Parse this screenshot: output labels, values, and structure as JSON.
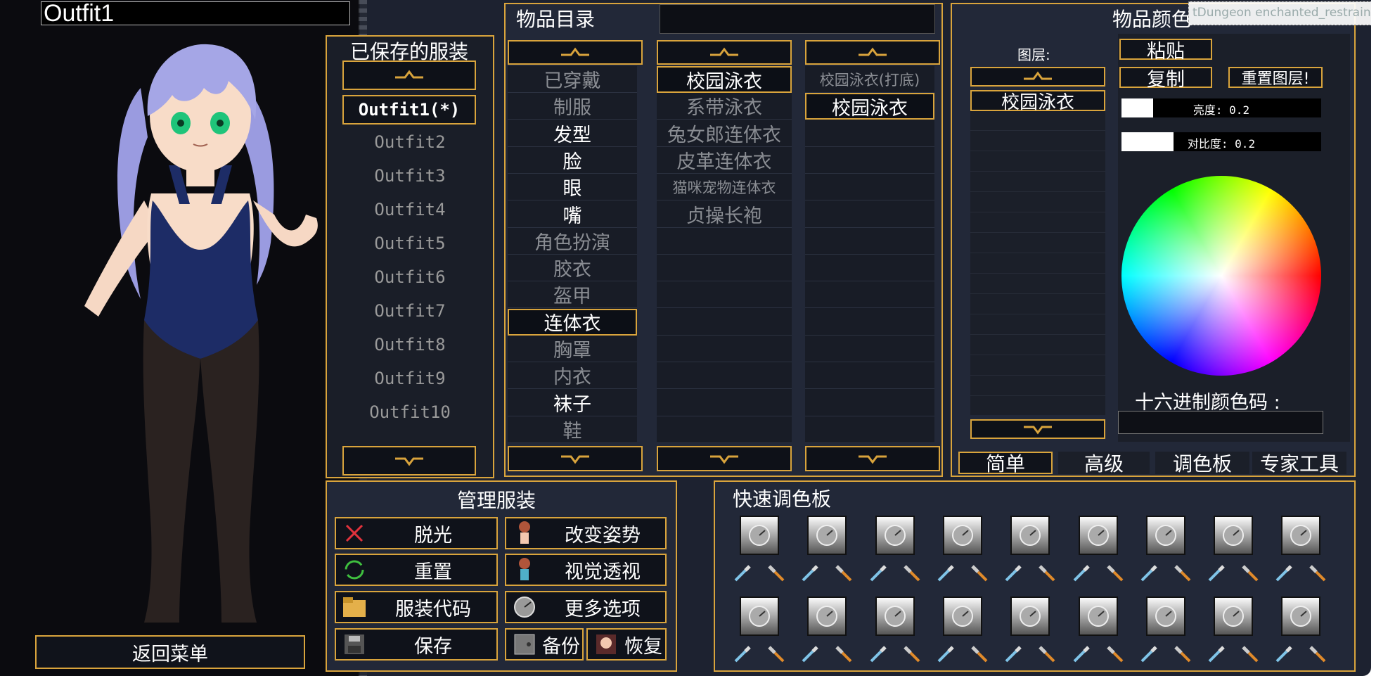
{
  "outfit_name": "Outfit1",
  "return_label": "返回菜单",
  "saved": {
    "title": "已保存的服装",
    "selected": "Outfit1(*)",
    "items": [
      "Outfit2",
      "Outfit3",
      "Outfit4",
      "Outfit5",
      "Outfit6",
      "Outfit7",
      "Outfit8",
      "Outfit9",
      "Outfit10"
    ]
  },
  "catalog": {
    "title": "物品目录",
    "search_value": "",
    "categories": [
      {
        "label": "已穿戴",
        "style": "dim"
      },
      {
        "label": "制服",
        "style": "dim"
      },
      {
        "label": "发型",
        "style": "bright"
      },
      {
        "label": "脸",
        "style": "bright"
      },
      {
        "label": "眼",
        "style": "bright"
      },
      {
        "label": "嘴",
        "style": "bright"
      },
      {
        "label": "角色扮演",
        "style": "dim"
      },
      {
        "label": "胶衣",
        "style": "dim"
      },
      {
        "label": "盔甲",
        "style": "dim"
      },
      {
        "label": "连体衣",
        "style": "selected"
      },
      {
        "label": "胸罩",
        "style": "dim"
      },
      {
        "label": "内衣",
        "style": "dim"
      },
      {
        "label": "袜子",
        "style": "bright"
      },
      {
        "label": "鞋",
        "style": "dim"
      }
    ],
    "items": [
      {
        "label": "校园泳衣",
        "style": "selected"
      },
      {
        "label": "系带泳衣",
        "style": "dim"
      },
      {
        "label": "兔女郎连体衣",
        "style": "dim"
      },
      {
        "label": "皮革连体衣",
        "style": "dim"
      },
      {
        "label": "猫咪宠物连体衣",
        "style": "dim"
      },
      {
        "label": "贞操长袍",
        "style": "dim"
      }
    ],
    "variants": [
      {
        "label": "校园泳衣(打底)",
        "style": "dim"
      },
      {
        "label": "校园泳衣",
        "style": "selected"
      }
    ]
  },
  "color": {
    "title": "物品颜色",
    "layers_label": "图层:",
    "layer_selected": "校园泳衣",
    "paste_label": "粘贴",
    "copy_label": "复制",
    "reset_layer_label": "重置图层!",
    "brightness_label": "亮度: 0.2",
    "brightness": 0.2,
    "contrast_label": "对比度: 0.2",
    "contrast": 0.2,
    "hex_label": "十六进制颜色码 :",
    "hex_value": "",
    "tabs": [
      "简单",
      "高级",
      "调色板",
      "专家工具"
    ],
    "selected_tab": 0
  },
  "manage": {
    "title": "管理服装",
    "strip_label": "脱光",
    "reset_label": "重置",
    "code_label": "服装代码",
    "save_label": "保存",
    "pose_label": "改变姿势",
    "xray_label": "视觉透视",
    "more_label": "更多选项",
    "backup_label": "备份",
    "restore_label": "恢复"
  },
  "palette": {
    "title": "快速调色板"
  },
  "window_title": "tDungeon enchanted_restraints Mod",
  "colors": {
    "accent": "#d9a43c",
    "panel": "#222838",
    "bg_dark": "#0b0b0f",
    "suit": "#1d2c66",
    "hair": "#a5a6e6"
  }
}
